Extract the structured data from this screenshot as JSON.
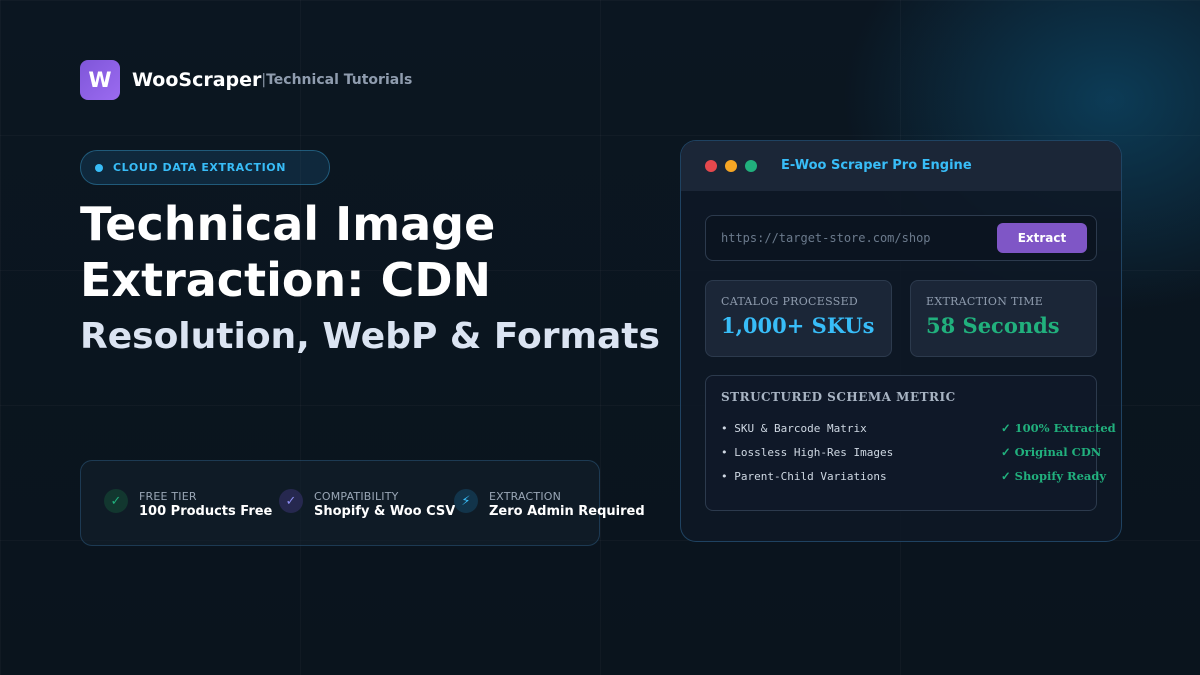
{
  "brand": {
    "logo_letter": "W",
    "name": "WooScraper",
    "separator": "|",
    "subtitle": "Technical Tutorials"
  },
  "badge": {
    "text": "CLOUD DATA EXTRACTION",
    "color": "#38bdf8"
  },
  "headline": {
    "line1": "Technical Image",
    "line2": "Extraction: CDN",
    "subline": "Resolution, WebP & Formats"
  },
  "features": [
    {
      "icon": "check-icon",
      "glyph": "✓",
      "label": "FREE TIER",
      "value": "100 Products Free",
      "icon_bg": "#12372f",
      "icon_color": "#21b07d"
    },
    {
      "icon": "check-icon",
      "glyph": "✓",
      "label": "COMPATIBILITY",
      "value": "Shopify & Woo CSV",
      "icon_bg": "#26284f",
      "icon_color": "#8b8cf0"
    },
    {
      "icon": "lightning-icon",
      "glyph": "⚡",
      "label": "EXTRACTION",
      "value": "Zero Admin Required",
      "icon_bg": "#12344a",
      "icon_color": "#38bdf8"
    }
  ],
  "engine": {
    "window_dots": [
      "#e5484d",
      "#f5a524",
      "#21b07d"
    ],
    "title": "E-Woo Scraper Pro Engine",
    "url_placeholder": "https://target-store.com/shop",
    "extract_label": "Extract",
    "stats": [
      {
        "label": "CATALOG PROCESSED",
        "value": "1,000+ SKUs",
        "color": "#38bdf8"
      },
      {
        "label": "EXTRACTION TIME",
        "value": "58 Seconds",
        "color": "#21b07d"
      }
    ],
    "schema": {
      "title": "STRUCTURED SCHEMA METRIC",
      "rows": [
        {
          "name": "• SKU & Barcode Matrix",
          "status": "✓ 100% Extracted"
        },
        {
          "name": "• Lossless High-Res Images",
          "status": "✓ Original CDN"
        },
        {
          "name": "• Parent-Child Variations",
          "status": "✓ Shopify Ready"
        }
      ]
    }
  }
}
